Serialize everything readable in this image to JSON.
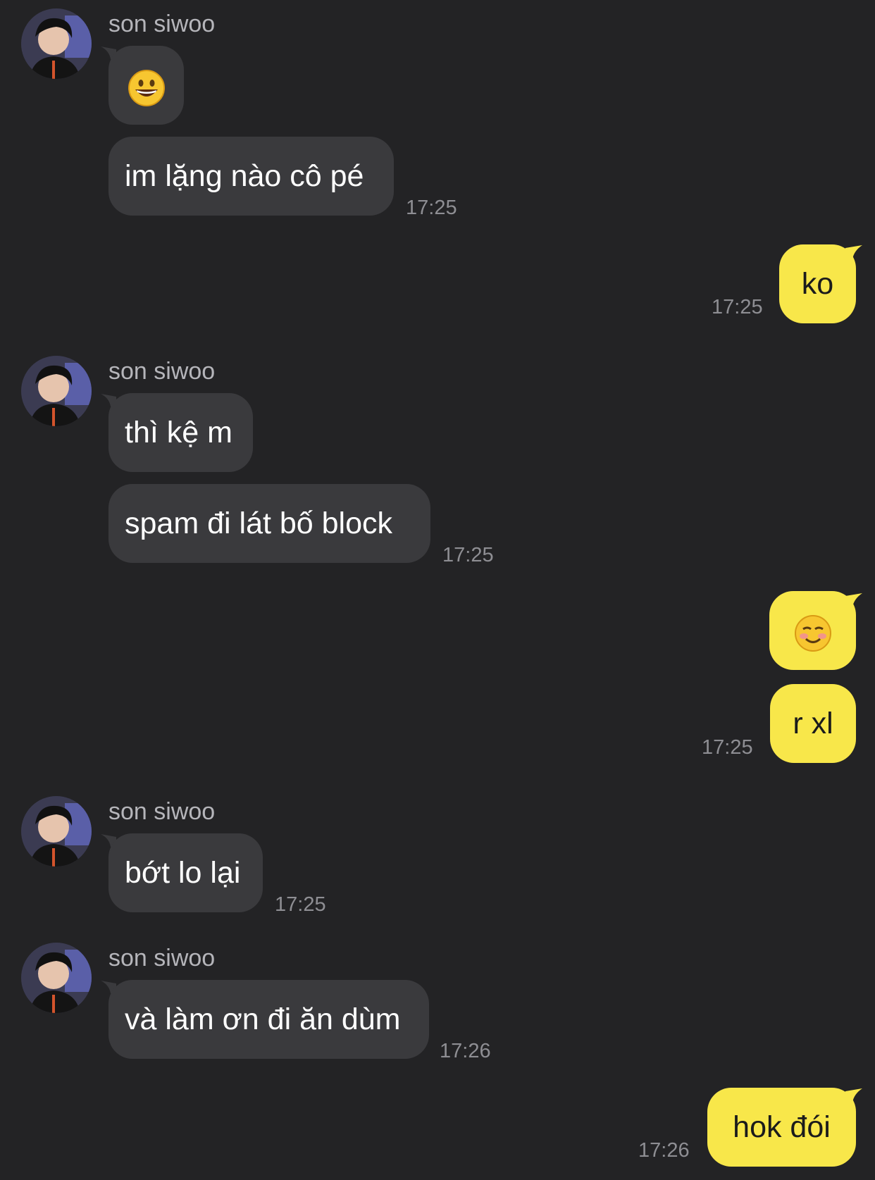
{
  "colors": {
    "background": "#232325",
    "incoming_bubble": "#3a3a3d",
    "outgoing_bubble": "#f8e74a",
    "name_text": "#b5b5ba",
    "time_text": "#8e8e93"
  },
  "contact": {
    "name": "son siwoo",
    "avatar": "profile-photo"
  },
  "messages": [
    {
      "sender": "son siwoo",
      "emoji": "grinning-face-emoji"
    },
    {
      "sender": "son siwoo",
      "text": "im lặng nào cô pé",
      "time": "17:25"
    },
    {
      "sender": "me",
      "text": "ko",
      "time": "17:25"
    },
    {
      "sender": "son siwoo",
      "text": "thì kệ m"
    },
    {
      "sender": "son siwoo",
      "text": "spam đi lát bố block",
      "time": "17:25"
    },
    {
      "sender": "me",
      "emoji": "smiling-face-emoji"
    },
    {
      "sender": "me",
      "text": "r xl",
      "time": "17:25"
    },
    {
      "sender": "son siwoo",
      "text": "bớt lo lại",
      "time": "17:25"
    },
    {
      "sender": "son siwoo",
      "text": "và làm ơn đi ăn dùm",
      "time": "17:26"
    },
    {
      "sender": "me",
      "text": "hok đói",
      "time": "17:26"
    }
  ]
}
